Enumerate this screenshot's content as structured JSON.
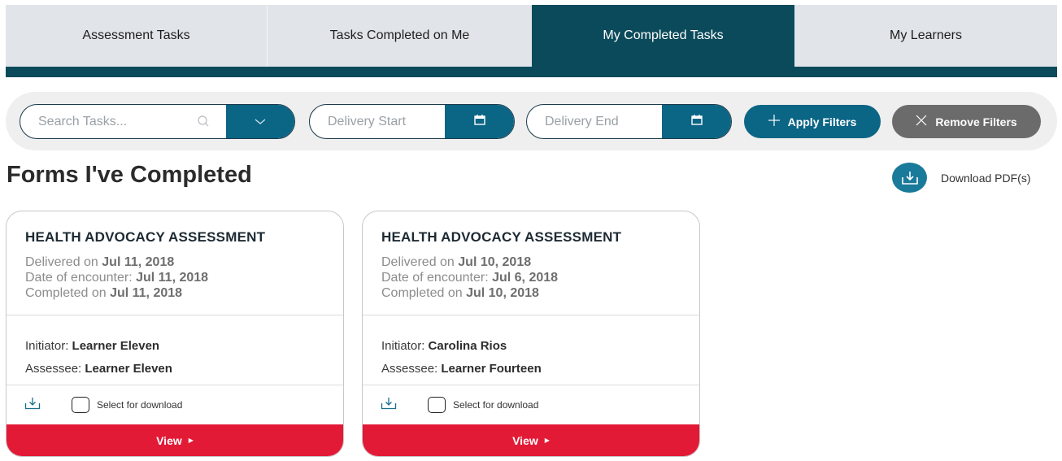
{
  "tabs": [
    {
      "label": "Assessment Tasks",
      "active": false
    },
    {
      "label": "Tasks Completed on Me",
      "active": false
    },
    {
      "label": "My Completed Tasks",
      "active": true
    },
    {
      "label": "My Learners",
      "active": false
    }
  ],
  "filters": {
    "search_placeholder": "Search Tasks...",
    "delivery_start_placeholder": "Delivery Start",
    "delivery_end_placeholder": "Delivery End",
    "apply_label": "Apply Filters",
    "remove_label": "Remove Filters"
  },
  "page": {
    "title": "Forms I've Completed",
    "download_pdf_label": "Download PDF(s)"
  },
  "cards": [
    {
      "title": "HEALTH ADVOCACY ASSESSMENT",
      "delivered_label": "Delivered on",
      "delivered": "Jul 11, 2018",
      "encounter_label": "Date of encounter:",
      "encounter": "Jul 11, 2018",
      "completed_label": "Completed on",
      "completed": "Jul 11, 2018",
      "initiator_label": "Initiator:",
      "initiator": "Learner Eleven",
      "assessee_label": "Assessee:",
      "assessee": "Learner Eleven",
      "select_label": "Select for download",
      "view_label": "View"
    },
    {
      "title": "HEALTH ADVOCACY ASSESSMENT",
      "delivered_label": "Delivered on",
      "delivered": "Jul 10, 2018",
      "encounter_label": "Date of encounter:",
      "encounter": "Jul 6, 2018",
      "completed_label": "Completed on",
      "completed": "Jul 10, 2018",
      "initiator_label": "Initiator:",
      "initiator": "Carolina Rios",
      "assessee_label": "Assessee:",
      "assessee": "Learner Fourteen",
      "select_label": "Select for download",
      "view_label": "View"
    }
  ],
  "colors": {
    "primary": "#0b6585",
    "active_tab": "#0b4a5b",
    "danger": "#e21a36",
    "neutral_button": "#6b6b6b"
  }
}
